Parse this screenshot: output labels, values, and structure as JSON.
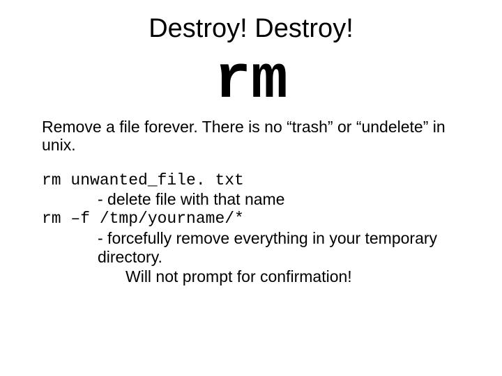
{
  "title": "Destroy! Destroy!",
  "command": "rm",
  "description": "Remove a file forever.  There is no “trash” or “undelete” in unix.",
  "example1_cmd": "rm unwanted_file. txt",
  "example1_note": "- delete file with that name",
  "example2_cmd": "rm –f /tmp/yourname/*",
  "example2_note": "- forcefully remove everything in your temporary directory.",
  "warning": "Will not prompt for confirmation!"
}
